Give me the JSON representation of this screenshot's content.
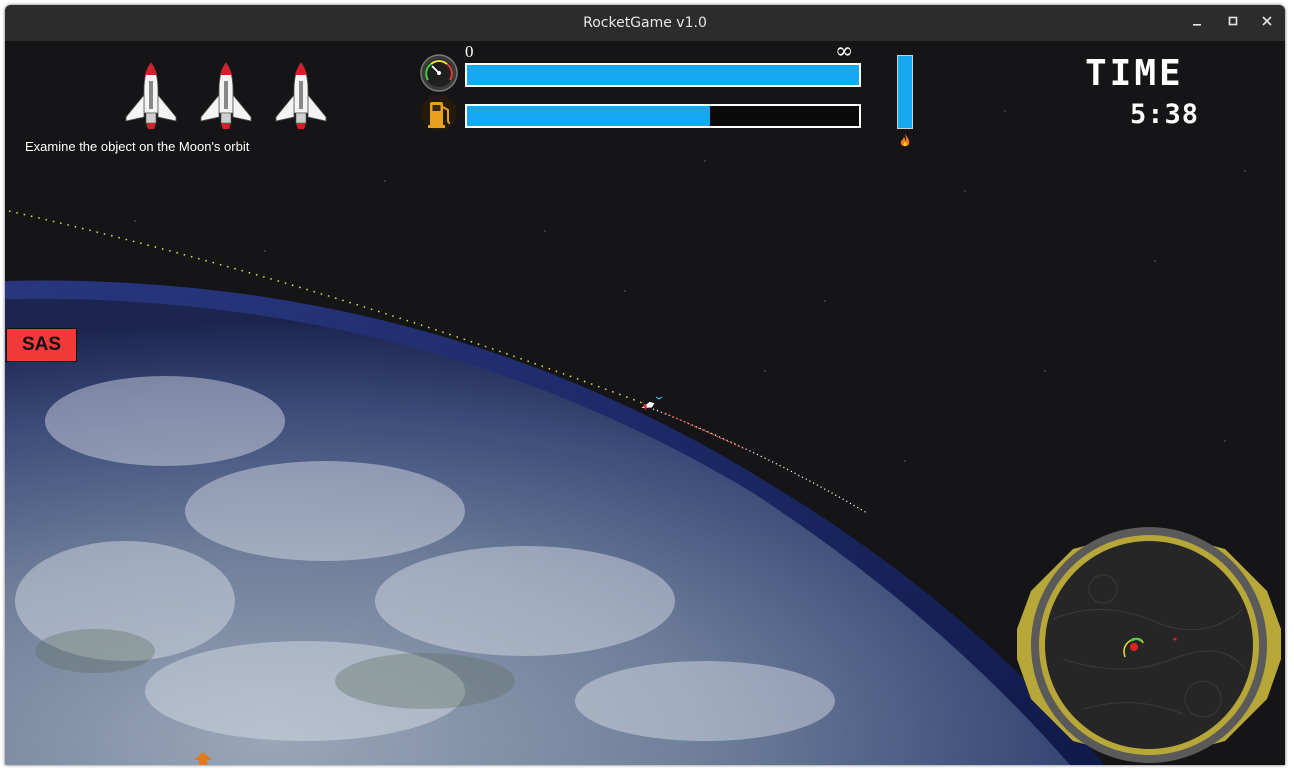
{
  "window": {
    "title": "RocketGame v1.0"
  },
  "hud": {
    "lives": 3,
    "mission_text": "Examine the object on the Moon's orbit",
    "speed": {
      "min_label": "0",
      "max_label": "∞",
      "fraction": 1.0
    },
    "fuel": {
      "fraction": 0.62
    },
    "thrust": {
      "fraction": 1.0
    },
    "time": {
      "label": "TIME",
      "value": "5:38"
    },
    "sas": {
      "label": "SAS",
      "state": "active",
      "color": "#f23a3a"
    }
  },
  "colors": {
    "bar_fill": "#16a8f0",
    "minimap_ring": "#b6a738",
    "space": "#151517",
    "trajectory_past": "#e3e34a"
  },
  "icons": [
    "speedometer-icon",
    "fuel-pump-icon",
    "flame-icon",
    "shuttle-icon",
    "rocket-icon",
    "minimap-radar"
  ]
}
